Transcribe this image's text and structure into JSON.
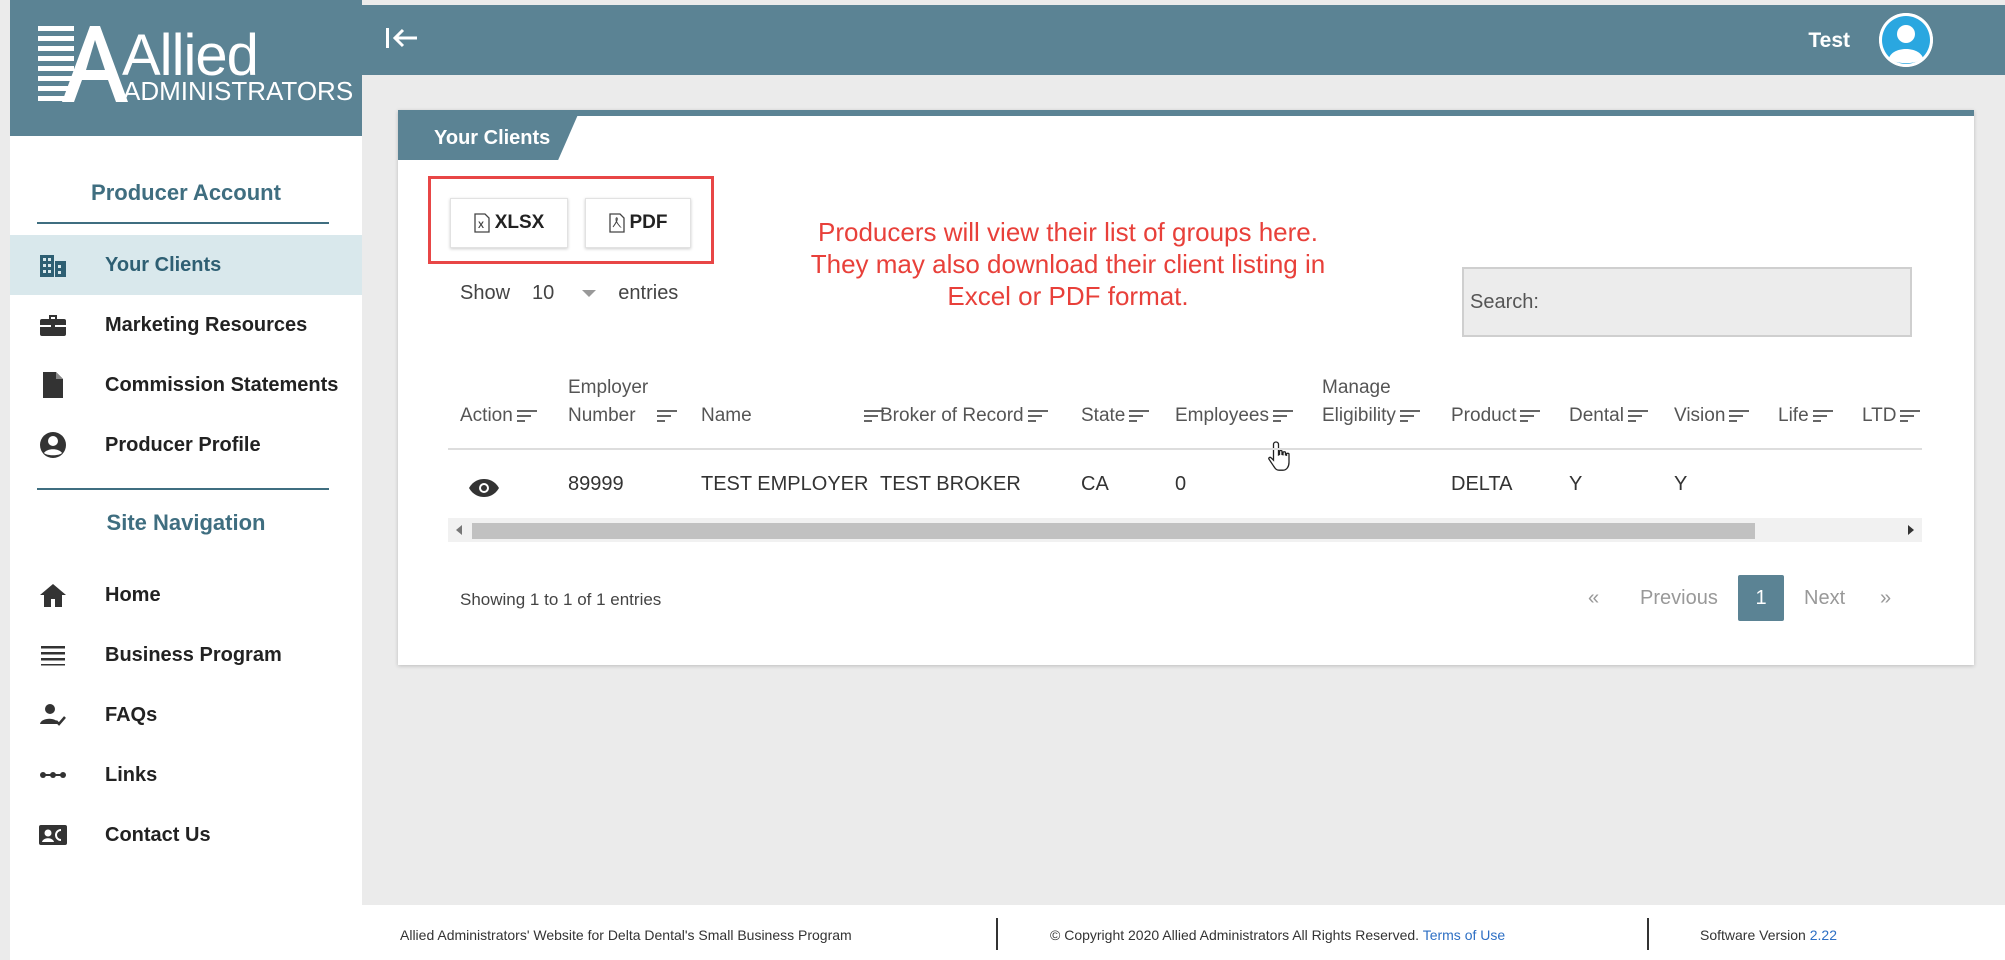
{
  "logo": {
    "word1": "Allied",
    "word2": "ADMINISTRATORS"
  },
  "sidebar": {
    "section1": "Producer Account",
    "items1": [
      {
        "label": "Your Clients",
        "icon": "building-icon"
      },
      {
        "label": "Marketing Resources",
        "icon": "briefcase-icon"
      },
      {
        "label": "Commission Statements",
        "icon": "document-icon"
      },
      {
        "label": "Producer Profile",
        "icon": "user-circle-icon"
      }
    ],
    "section2": "Site Navigation",
    "items2": [
      {
        "label": "Home",
        "icon": "home-icon"
      },
      {
        "label": "Business Program",
        "icon": "list-icon"
      },
      {
        "label": "FAQs",
        "icon": "user-check-icon"
      },
      {
        "label": "Links",
        "icon": "links-icon"
      },
      {
        "label": "Contact Us",
        "icon": "contact-card-icon"
      }
    ]
  },
  "topbar": {
    "user": "Test"
  },
  "card": {
    "tab": "Your Clients",
    "xlsx_label": "XLSX",
    "pdf_label": "PDF",
    "annotation": [
      "Producers will view their list of groups here.",
      "They may also download their client listing in",
      "Excel or PDF format."
    ],
    "show_label": "Show",
    "show_value": "10",
    "entries_label": "entries",
    "search_label": "Search:",
    "columns": [
      {
        "l1": "",
        "l2": "Action"
      },
      {
        "l1": "Employer",
        "l2": "Number"
      },
      {
        "l1": "",
        "l2": "Name"
      },
      {
        "l1": "",
        "l2": "Broker of Record"
      },
      {
        "l1": "",
        "l2": "State"
      },
      {
        "l1": "",
        "l2": "Employees"
      },
      {
        "l1": "Manage",
        "l2": "Eligibility"
      },
      {
        "l1": "",
        "l2": "Product"
      },
      {
        "l1": "",
        "l2": "Dental"
      },
      {
        "l1": "",
        "l2": "Vision"
      },
      {
        "l1": "",
        "l2": "Life"
      },
      {
        "l1": "",
        "l2": "LTD"
      }
    ],
    "row": {
      "employer_number": "89999",
      "name": "TEST EMPLOYER",
      "broker": "TEST BROKER",
      "state": "CA",
      "employees": "0",
      "product": "DELTA",
      "dental": "Y",
      "vision": "Y"
    },
    "info": "Showing 1 to 1 of 1 entries",
    "pager": {
      "first": "«",
      "previous": "Previous",
      "page": "1",
      "next": "Next",
      "last": "»"
    }
  },
  "footer": {
    "left": "Allied Administrators' Website for Delta Dental's Small Business Program",
    "copyright": "© Copyright 2020 Allied Administrators All Rights Reserved.",
    "terms": "Terms of Use",
    "version_label": "Software Version",
    "version": "2.22"
  },
  "colors": {
    "brand": "#5b8394",
    "annotation": "#e8403a",
    "active_bg": "#d9e8ec"
  }
}
